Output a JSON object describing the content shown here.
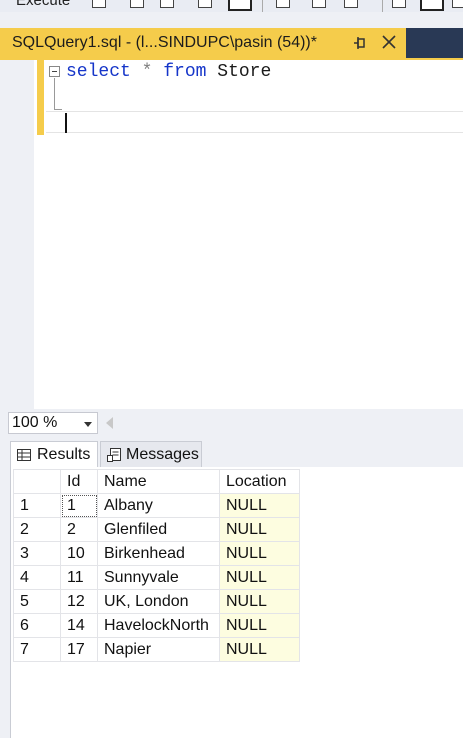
{
  "toolbar": {
    "execute_label": "Execute"
  },
  "document_tab": {
    "title": "SQLQuery1.sql - (l...SINDUPC\\pasin (54))*"
  },
  "editor": {
    "line1": {
      "keyword_select": "select",
      "star": "*",
      "keyword_from": "from",
      "table": "Store"
    }
  },
  "zoom": {
    "value": "100 %"
  },
  "results_tabs": {
    "results": "Results",
    "messages": "Messages"
  },
  "grid": {
    "columns": [
      "Id",
      "Name",
      "Location"
    ],
    "rows": [
      {
        "n": "1",
        "id": "1",
        "name": "Albany",
        "location": "NULL"
      },
      {
        "n": "2",
        "id": "2",
        "name": "Glenfiled",
        "location": "NULL"
      },
      {
        "n": "3",
        "id": "10",
        "name": "Birkenhead",
        "location": "NULL"
      },
      {
        "n": "4",
        "id": "11",
        "name": "Sunnyvale",
        "location": "NULL"
      },
      {
        "n": "5",
        "id": "12",
        "name": "UK, London",
        "location": "NULL"
      },
      {
        "n": "6",
        "id": "14",
        "name": "HavelockNorth",
        "location": "NULL"
      },
      {
        "n": "7",
        "id": "17",
        "name": "Napier",
        "location": "NULL"
      }
    ]
  },
  "colors": {
    "tab_accent": "#f5cc4b",
    "keyword": "#1535c9",
    "null_cell": "#fdfde0",
    "tab_strip_dark": "#293955"
  },
  "icons": {
    "pin": "pin-icon",
    "close": "close-icon",
    "results": "grid-icon",
    "messages": "messages-icon"
  }
}
